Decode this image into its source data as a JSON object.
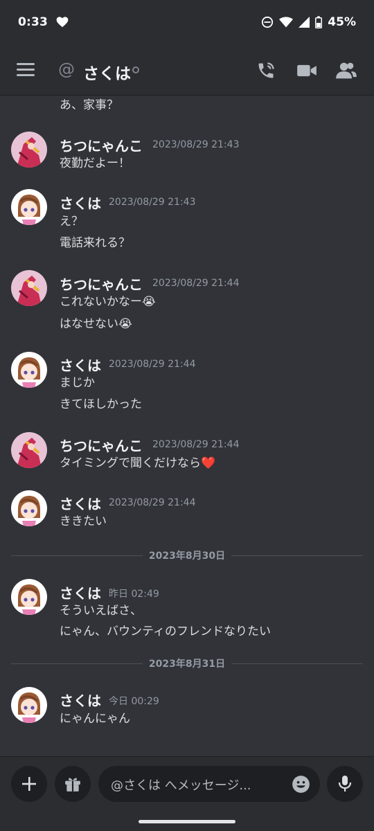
{
  "statusbar": {
    "time": "0:33",
    "battery": "45%"
  },
  "header": {
    "at_symbol": "@",
    "title": "さくは"
  },
  "messages": {
    "partial_text": "あ、家事？",
    "groups": [
      {
        "author": "ちつにゃんこ",
        "timestamp": "2023/08/29 21:43",
        "lines": [
          "夜勤だよー！"
        ]
      },
      {
        "author": "さくは",
        "timestamp": "2023/08/29 21:43",
        "lines": [
          "え？",
          "電話来れる？"
        ]
      },
      {
        "author": "ちつにゃんこ",
        "timestamp": "2023/08/29 21:44",
        "lines": [
          "これないかなー😭",
          "はなせない😭"
        ]
      },
      {
        "author": "さくは",
        "timestamp": "2023/08/29 21:44",
        "lines": [
          "まじか",
          "きてほしかった"
        ]
      },
      {
        "author": "ちつにゃんこ",
        "timestamp": "2023/08/29 21:44",
        "lines": [
          "タイミングで聞くだけなら❤️"
        ]
      },
      {
        "author": "さくは",
        "timestamp": "2023/08/29 21:44",
        "lines": [
          "ききたい"
        ]
      },
      {
        "author": "さくは",
        "timestamp": "昨日 02:49",
        "lines": [
          "そういえばさ、",
          "にゃん、バウンティのフレンドなりたい"
        ]
      },
      {
        "author": "さくは",
        "timestamp": "今日 00:29",
        "lines": [
          "にゃんにゃん"
        ]
      }
    ],
    "dividers": [
      "2023年8月30日",
      "2023年8月31日"
    ]
  },
  "composer": {
    "placeholder": "@さくは へメッセージ..."
  },
  "colors": {
    "background": "#313338",
    "header": "#2b2d31",
    "input": "#1e1f22",
    "muted": "#949ba4"
  }
}
